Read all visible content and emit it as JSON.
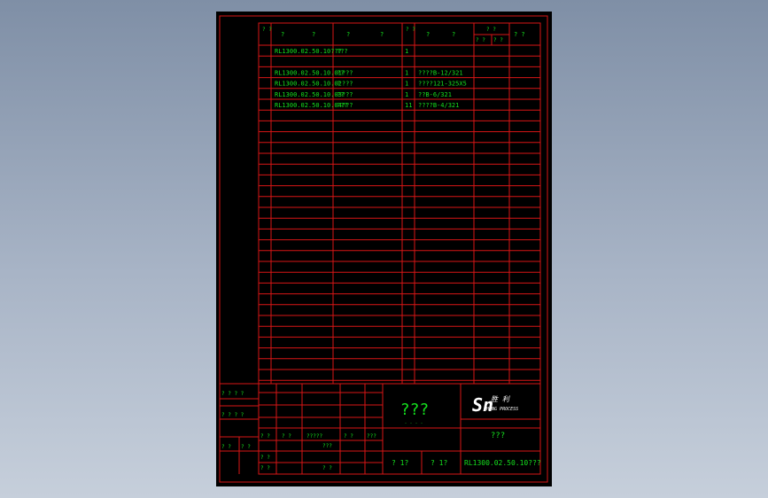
{
  "header": {
    "c1": "? ?",
    "c2": "?",
    "c3": "?",
    "c4": "?",
    "c5": "?",
    "c6": "? ?",
    "c7": "?",
    "c8": "?",
    "c9a": "? ?",
    "c9b": "? ?",
    "c9c": "? ?",
    "c10": "? ?"
  },
  "rows": [
    {
      "code": "RL1300.02.50.10???",
      "name": "???",
      "qty": "1",
      "material": ""
    },
    {
      "code": "",
      "name": "",
      "qty": "",
      "material": ""
    },
    {
      "code": "RL1300.02.50.10.01???",
      "name": "??",
      "qty": "1",
      "material": "????B-12/321"
    },
    {
      "code": "RL1300.02.50.10.02???",
      "name": "?",
      "qty": "1",
      "material": "????121-325X5"
    },
    {
      "code": "RL1300.02.50.10.03???",
      "name": "??",
      "qty": "1",
      "material": "??B-6/321"
    },
    {
      "code": "RL1300.02.50.10.04???",
      "name": "???",
      "qty": "11",
      "material": "????B-4/321"
    }
  ],
  "side": {
    "label1": "? ? ?  ?",
    "label2": "? ? ? ?",
    "label3a": "? ?",
    "label3b": "? ?"
  },
  "title_block": {
    "left": {
      "a": "? ?",
      "b": "? ?",
      "c": "?????",
      "d": "? ?",
      "e": "???",
      "f": "???",
      "g": "? ?",
      "h": "? ?",
      "i": "? ?"
    },
    "center_title": "???",
    "center_dots": ". . . .",
    "logo_main": "Sn",
    "logo_sub": "SHENG PROCESS",
    "logo_small": "胜 利",
    "company": "???",
    "sheet_a": "? 1?",
    "sheet_b": "? 1?",
    "drawing_no": "RL1300.02.50.10???"
  },
  "colors": {
    "border": "#d81616",
    "text": "#15e01e",
    "white_text": "#ffffff",
    "background": "#000000"
  }
}
